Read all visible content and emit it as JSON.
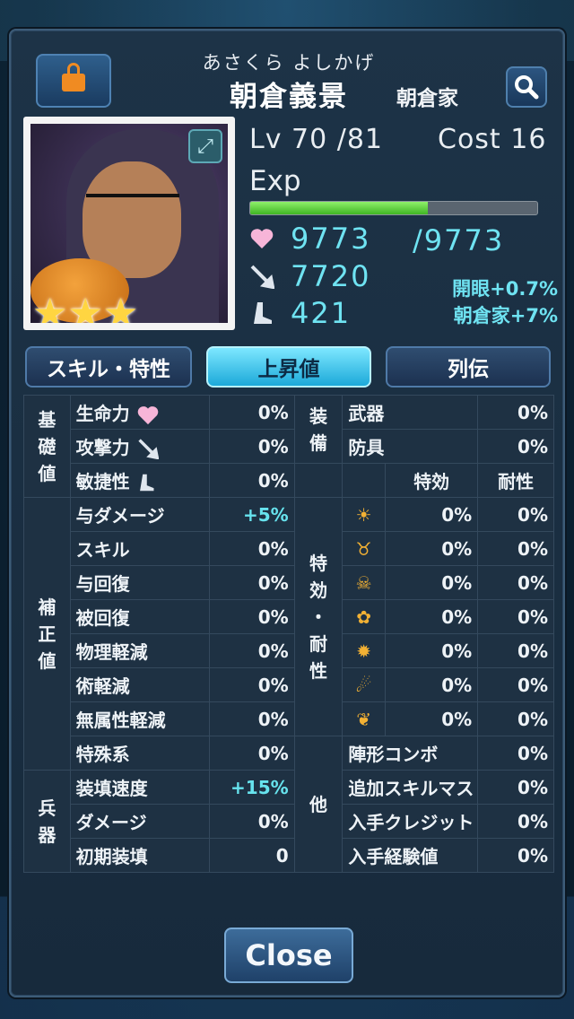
{
  "header": {
    "reading": "あさくら よしかげ",
    "name": "朝倉義景",
    "clan": "朝倉家"
  },
  "card": {
    "rarity_stars": 3,
    "level_text": "Lv 70 /81",
    "cost_text": "Cost 16",
    "exp_label": "Exp",
    "exp_progress": 0.62,
    "hp_current": "9773",
    "hp_max": "/9773",
    "attack": "7720",
    "agility": "421",
    "bonus_awaken": "開眼+0.7%",
    "bonus_clan": "朝倉家+7%"
  },
  "tabs": [
    {
      "label": "スキル・特性"
    },
    {
      "label": "上昇値"
    },
    {
      "label": "列伝"
    }
  ],
  "table": {
    "basic_cat": "基\n礎\n値",
    "correction_cat": "補\n正\n値",
    "weapon_cat": "兵\n器",
    "equip_cat": "装\n備",
    "special_cat": "特\n効\n・\n耐\n性",
    "other_cat": "他",
    "basic": [
      {
        "label": "生命力",
        "value": "0%"
      },
      {
        "label": "攻撃力",
        "value": "0%"
      },
      {
        "label": "敏捷性",
        "value": "0%"
      }
    ],
    "correction": [
      {
        "label": "与ダメージ",
        "value": "+5%"
      },
      {
        "label": "スキル",
        "value": "0%"
      },
      {
        "label": "与回復",
        "value": "0%"
      },
      {
        "label": "被回復",
        "value": "0%"
      },
      {
        "label": "物理軽減",
        "value": "0%"
      },
      {
        "label": "術軽減",
        "value": "0%"
      },
      {
        "label": "無属性軽減",
        "value": "0%"
      },
      {
        "label": "特殊系",
        "value": "0%"
      }
    ],
    "weapon": [
      {
        "label": "装填速度",
        "value": "+15%"
      },
      {
        "label": "ダメージ",
        "value": "0%"
      },
      {
        "label": "初期装填",
        "value": "0"
      }
    ],
    "equip": [
      {
        "label": "武器",
        "value": "0%"
      },
      {
        "label": "防具",
        "value": "0%"
      }
    ],
    "special_headers": {
      "effect": "特効",
      "resist": "耐性"
    },
    "special": [
      {
        "icon": "sun-icon",
        "effect": "0%",
        "resist": "0%"
      },
      {
        "icon": "beast-icon",
        "effect": "0%",
        "resist": "0%"
      },
      {
        "icon": "skull-icon",
        "effect": "0%",
        "resist": "0%"
      },
      {
        "icon": "paw-icon",
        "effect": "0%",
        "resist": "0%"
      },
      {
        "icon": "gear-icon",
        "effect": "0%",
        "resist": "0%"
      },
      {
        "icon": "spiral-icon",
        "effect": "0%",
        "resist": "0%"
      },
      {
        "icon": "wing-icon",
        "effect": "0%",
        "resist": "0%"
      }
    ],
    "other": [
      {
        "label": "陣形コンボ",
        "value": "0%"
      },
      {
        "label": "追加スキルマス",
        "value": "0%"
      },
      {
        "label": "入手クレジット",
        "value": "0%"
      },
      {
        "label": "入手経験値",
        "value": "0%"
      }
    ]
  },
  "close_label": "Close",
  "colors": {
    "accent_cyan": "#6fe3f2",
    "exp_green": "#3fb524",
    "lock_orange": "#f08b22",
    "star_gold": "#ffd541"
  }
}
